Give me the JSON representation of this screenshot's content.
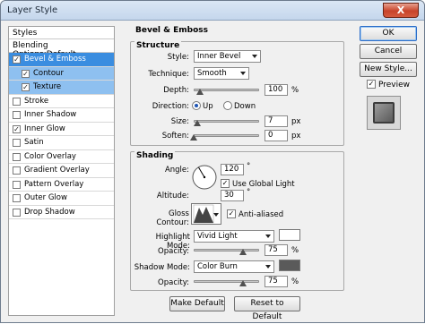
{
  "window": {
    "title": "Layer Style",
    "close_label": "X"
  },
  "styles": {
    "header": "Styles",
    "blending": "Blending Options:Default",
    "items": [
      {
        "label": "Bevel & Emboss",
        "checked": "✓"
      },
      {
        "label": "Contour",
        "checked": "✓"
      },
      {
        "label": "Texture",
        "checked": "✓"
      },
      {
        "label": "Stroke",
        "checked": ""
      },
      {
        "label": "Inner Shadow",
        "checked": ""
      },
      {
        "label": "Inner Glow",
        "checked": "✓"
      },
      {
        "label": "Satin",
        "checked": ""
      },
      {
        "label": "Color Overlay",
        "checked": ""
      },
      {
        "label": "Gradient Overlay",
        "checked": ""
      },
      {
        "label": "Pattern Overlay",
        "checked": ""
      },
      {
        "label": "Outer Glow",
        "checked": ""
      },
      {
        "label": "Drop Shadow",
        "checked": ""
      }
    ]
  },
  "bevel": {
    "title": "Bevel & Emboss",
    "structure": {
      "title": "Structure",
      "style_label": "Style:",
      "style_value": "Inner Bevel",
      "technique_label": "Technique:",
      "technique_value": "Smooth",
      "depth_label": "Depth:",
      "depth_value": "100",
      "depth_unit": "%",
      "depth_level": 0.1,
      "direction_label": "Direction:",
      "up_label": "Up",
      "down_label": "Down",
      "size_label": "Size:",
      "size_value": "7",
      "size_unit": "px",
      "size_level": 0.05,
      "soften_label": "Soften:",
      "soften_value": "0",
      "soften_unit": "px",
      "soften_level": 0.0
    },
    "shading": {
      "title": "Shading",
      "angle_label": "Angle:",
      "angle_value": "120",
      "angle_unit": "°",
      "global_light_label": "Use Global Light",
      "global_light_checked": "✓",
      "altitude_label": "Altitude:",
      "altitude_value": "30",
      "altitude_unit": "°",
      "gloss_label": "Gloss Contour:",
      "anti_aliased_label": "Anti-aliased",
      "anti_aliased_checked": "✓",
      "highlight_mode_label": "Highlight Mode:",
      "highlight_mode_value": "Vivid Light",
      "highlight_color": "#ffffff",
      "highlight_opacity_label": "Opacity:",
      "highlight_opacity_value": "75",
      "highlight_opacity_unit": "%",
      "highlight_opacity_level": 0.75,
      "shadow_mode_label": "Shadow Mode:",
      "shadow_mode_value": "Color Burn",
      "shadow_color": "#5a5a5a",
      "shadow_opacity_label": "Opacity:",
      "shadow_opacity_value": "75",
      "shadow_opacity_unit": "%",
      "shadow_opacity_level": 0.75
    },
    "make_default_label": "Make Default",
    "reset_default_label": "Reset to Default"
  },
  "actions": {
    "ok_label": "OK",
    "cancel_label": "Cancel",
    "new_style_label": "New Style...",
    "preview_label": "Preview",
    "preview_checked": "✓"
  },
  "colors": {
    "selected_row": "#3a8de0",
    "sub_selected_row": "#8ec0f0"
  }
}
